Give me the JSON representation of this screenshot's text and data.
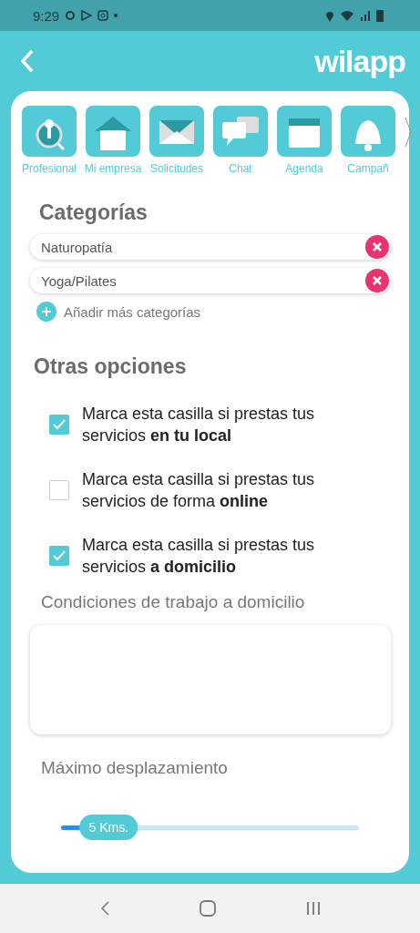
{
  "status_bar": {
    "time": "9:29"
  },
  "header": {
    "logo": "wilapp"
  },
  "nav_tabs": [
    {
      "label": "Profesional",
      "kind": "person"
    },
    {
      "label": "Mi empresa",
      "kind": "house"
    },
    {
      "label": "Solicitudes",
      "kind": "mail"
    },
    {
      "label": "Chat",
      "kind": "chat"
    },
    {
      "label": "Agenda",
      "kind": "calendar"
    },
    {
      "label": "Campañ",
      "kind": "bell"
    }
  ],
  "categories": {
    "title": "Categorías",
    "items": [
      "Naturopatía",
      "Yoga/Pilates"
    ],
    "add_label": "Añadir más categorías"
  },
  "options": {
    "title": "Otras opciones",
    "items": [
      {
        "text": "Marca esta casilla si prestas tus servicios **en tu local**",
        "checked": true
      },
      {
        "text": "Marca esta casilla si prestas tus servicios de forma **online**",
        "checked": false
      },
      {
        "text": "Marca esta casilla si prestas tus servicios **a domicilio**",
        "checked": true
      }
    ]
  },
  "conditions": {
    "label": "Condiciones de trabajo a domicilio"
  },
  "distance": {
    "label": "Máximo desplazamiento",
    "reading": "5 Kms.",
    "level": 0.16
  }
}
